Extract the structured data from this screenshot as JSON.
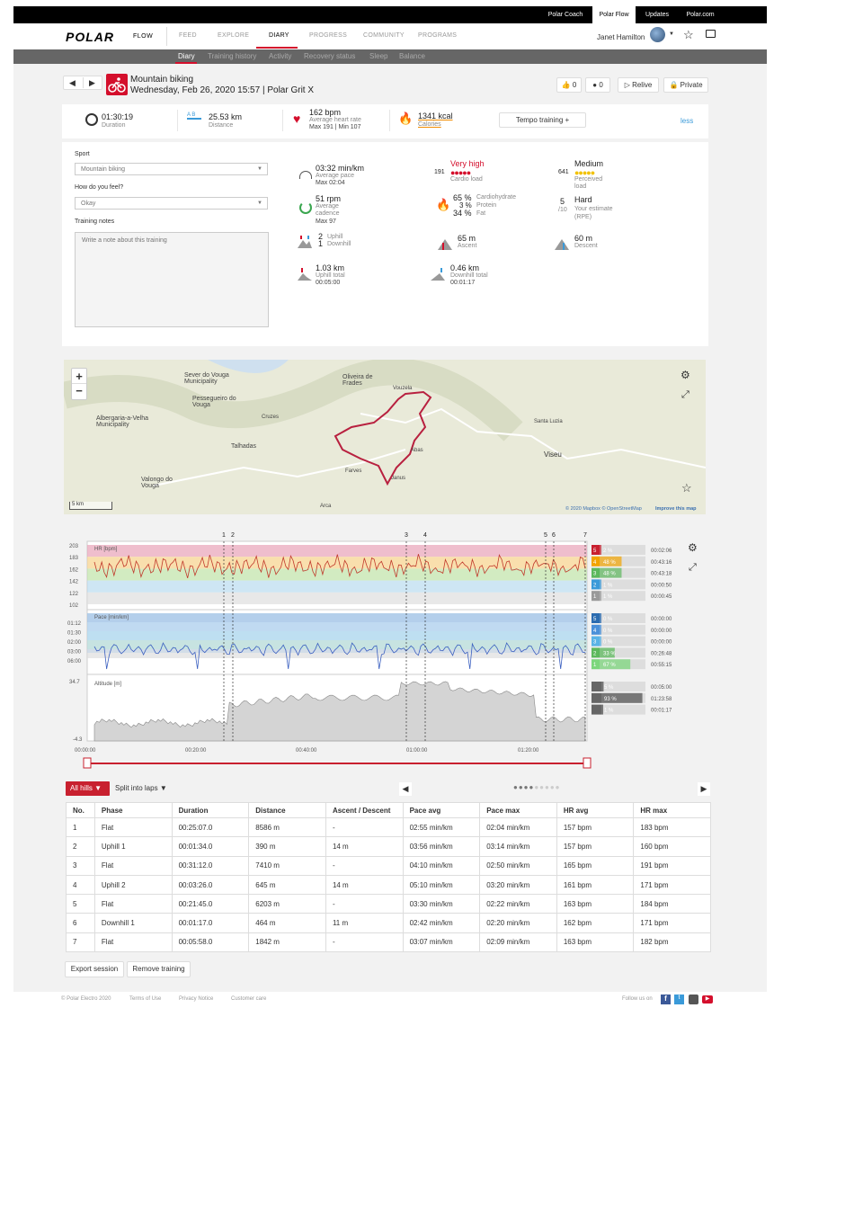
{
  "topbar": {
    "coach": "Polar Coach",
    "flow": "Polar Flow",
    "updates": "Updates",
    "polarcom": "Polar.com"
  },
  "nav": {
    "logo": "POLAR",
    "flow": "FLOW",
    "items": [
      "FEED",
      "EXPLORE",
      "DIARY",
      "PROGRESS",
      "COMMUNITY",
      "PROGRAMS"
    ],
    "user": "Janet Hamilton"
  },
  "subnav": [
    "Diary",
    "Training history",
    "Activity",
    "Recovery status",
    "Sleep",
    "Balance"
  ],
  "session": {
    "sport": "Mountain biking",
    "date": "Wednesday, Feb 26, 2020 15:57 | Polar Grit X",
    "likes": "0",
    "comments": "0",
    "relive": "Relive",
    "private": "Private"
  },
  "summary": {
    "duration": "01:30:19",
    "duration_label": "Duration",
    "distance": "25.53 km",
    "distance_label": "Distance",
    "hr": "162 bpm",
    "hr_label": "Average heart rate",
    "hr_sub": "Max 191 | Min 107",
    "kcal": "1341 kcal",
    "kcal_label": "Calories",
    "tempo": "Tempo training +",
    "less": "less"
  },
  "form": {
    "sport_label": "Sport",
    "sport_value": "Mountain biking",
    "feel_label": "How do you feel?",
    "feel_value": "Okay",
    "notes_label": "Training notes",
    "notes_placeholder": "Write a note about this training"
  },
  "stats": {
    "pace": "03:32 min/km",
    "pace_label": "Average pace",
    "pace_max": "Max 02:04",
    "cadence": "51 rpm",
    "cadence_l1": "Average",
    "cadence_l2": "cadence",
    "cadence_max": "Max 97",
    "hills_up": "2",
    "hills_up_l": "Uphill",
    "hills_down": "1",
    "hills_down_l": "Downhill",
    "up_total": "1.03 km",
    "up_total_l": "Uphill total",
    "up_time": "00:05:00",
    "cardio_num": "191",
    "cardio": "Very high",
    "cardio_label": "Cardio load",
    "carb": "65 %",
    "carb_l": "Cardiohydrate",
    "prot": "3 %",
    "prot_l": "Protein",
    "fat": "34 %",
    "fat_l": "Fat",
    "ascent": "65 m",
    "ascent_l": "Ascent",
    "down_total": "0.46 km",
    "down_total_l": "Downhill total",
    "down_time": "00:01:17",
    "perc_num": "641",
    "perc": "Medium",
    "perc_l1": "Perceived",
    "perc_l2": "load",
    "rpe_num": "5",
    "rpe_den": "/10",
    "rpe": "Hard",
    "rpe_l1": "Your estimate",
    "rpe_l2": "(RPE)",
    "descent": "60 m",
    "descent_l": "Descent"
  },
  "map": {
    "places": [
      "Sever do Vouga Municipality",
      "Oliveira de Frades",
      "Pessegueiro do Vouga",
      "Albergaria-a-Velha Municipality",
      "Talhadas",
      "Valongo do Vouga",
      "Viseu",
      "Santa Luzia",
      "Farves",
      "Janus",
      "Abas",
      "Arca",
      "Cruzes",
      "Vouzela"
    ],
    "scale": "5 km",
    "credit": "© 2020 Mapbox © OpenStreetMap",
    "improve": "Improve this map"
  },
  "chart": {
    "hr_label": "HR [bpm]",
    "pace_label": "Pace [min/km]",
    "alt_label": "Altitude [m]",
    "hr_ticks": [
      "203",
      "183",
      "162",
      "142",
      "122",
      "102"
    ],
    "pace_ticks": [
      "01:12",
      "01:30",
      "02:00",
      "03:00",
      "06:00"
    ],
    "alt_ticks": [
      "34.7",
      "-4.3"
    ],
    "x_ticks": [
      "00:00:00",
      "00:20:00",
      "00:40:00",
      "01:00:00",
      "01:20:00"
    ],
    "markers": [
      "1",
      "2",
      "3",
      "4",
      "5",
      "6",
      "7"
    ],
    "hr_zones": [
      {
        "z": "5",
        "pct": "2 %",
        "time": "00:02:06"
      },
      {
        "z": "4",
        "pct": "48 %",
        "time": "00:43:16"
      },
      {
        "z": "3",
        "pct": "48 %",
        "time": "00:43:18"
      },
      {
        "z": "2",
        "pct": "1 %",
        "time": "00:00:50"
      },
      {
        "z": "1",
        "pct": "1 %",
        "time": "00:00:45"
      }
    ],
    "pace_zones": [
      {
        "z": "5",
        "pct": "0 %",
        "time": "00:00:00"
      },
      {
        "z": "4",
        "pct": "0 %",
        "time": "00:00:00"
      },
      {
        "z": "3",
        "pct": "0 %",
        "time": "00:00:00"
      },
      {
        "z": "2",
        "pct": "33 %",
        "time": "00:26:48"
      },
      {
        "z": "1",
        "pct": "67 %",
        "time": "00:55:15"
      }
    ],
    "alt_zones": [
      {
        "pct": "5 %",
        "time": "00:05:00"
      },
      {
        "pct": "93 %",
        "time": "01:23:58"
      },
      {
        "pct": "1 %",
        "time": "00:01:17"
      }
    ]
  },
  "controls": {
    "hills": "All hills",
    "split": "Split into laps"
  },
  "table": {
    "headers": [
      "No.",
      "Phase",
      "Duration",
      "Distance",
      "Ascent / Descent",
      "Pace avg",
      "Pace max",
      "HR avg",
      "HR max"
    ],
    "rows": [
      [
        "1",
        "Flat",
        "00:25:07.0",
        "8586 m",
        "-",
        "02:55 min/km",
        "02:04 min/km",
        "157 bpm",
        "183 bpm"
      ],
      [
        "2",
        "Uphill 1",
        "00:01:34.0",
        "390 m",
        "14 m",
        "03:56 min/km",
        "03:14 min/km",
        "157 bpm",
        "160 bpm"
      ],
      [
        "3",
        "Flat",
        "00:31:12.0",
        "7410 m",
        "-",
        "04:10 min/km",
        "02:50 min/km",
        "165 bpm",
        "191 bpm"
      ],
      [
        "4",
        "Uphill 2",
        "00:03:26.0",
        "645 m",
        "14 m",
        "05:10 min/km",
        "03:20 min/km",
        "161 bpm",
        "171 bpm"
      ],
      [
        "5",
        "Flat",
        "00:21:45.0",
        "6203 m",
        "-",
        "03:30 min/km",
        "02:22 min/km",
        "163 bpm",
        "184 bpm"
      ],
      [
        "6",
        "Downhill 1",
        "00:01:17.0",
        "464 m",
        "11 m",
        "02:42 min/km",
        "02:20 min/km",
        "162 bpm",
        "171 bpm"
      ],
      [
        "7",
        "Flat",
        "00:05:58.0",
        "1842 m",
        "-",
        "03:07 min/km",
        "02:09 min/km",
        "163 bpm",
        "182 bpm"
      ]
    ]
  },
  "actions": {
    "export": "Export session",
    "remove": "Remove training"
  },
  "footer": {
    "copy": "© Polar Electro 2020",
    "terms": "Terms of Use",
    "privacy": "Privacy Notice",
    "care": "Customer care",
    "follow": "Follow us on"
  }
}
